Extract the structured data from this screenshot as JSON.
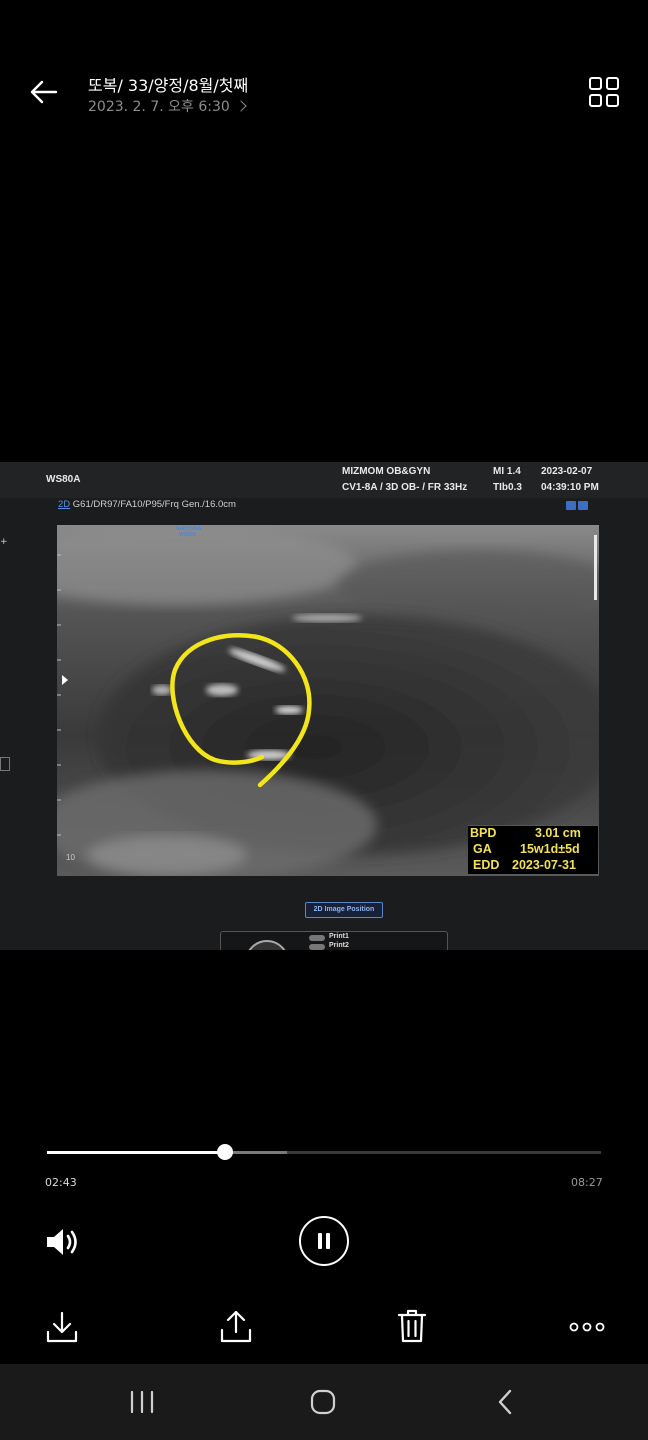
{
  "header": {
    "title": "또복/ 33/양정/8월/첫째",
    "subtitle": "2023. 2. 7. 오후 6:30"
  },
  "ultrasound": {
    "model": "WS80A",
    "clinic": "MIZMOM OB&GYN",
    "probe": "CV1-8A / 3D OB- / FR 33Hz",
    "mi": "MI  1.4",
    "tib": "TIb0.3",
    "date": "2023-02-07",
    "time": "04:39:10 PM",
    "mode": "2D",
    "params": "G61/DR97/FA10/P95/Frq Gen./16.0cm",
    "logo_line1": "SAMSUNG",
    "logo_line2": "WS80A",
    "depth_label": "10",
    "measurements": {
      "bpd_label": "BPD",
      "bpd_value": "3.01 cm",
      "ga_label": "GA",
      "ga_value": "15w1d±5d",
      "edd_label": "EDD",
      "edd_value": "2023-07-31"
    },
    "position_button": "2D Image Position",
    "print1": "Print1",
    "print2": "Print2",
    "annotation_color": "#f2e61a"
  },
  "player": {
    "current_time": "02:43",
    "duration": "08:27",
    "progress": 0.321,
    "buffered": 0.433
  },
  "icons": {
    "back": "back-arrow-icon",
    "grid": "grid-view-icon",
    "volume": "volume-icon",
    "pause": "pause-icon",
    "download": "download-icon",
    "share": "share-icon",
    "delete": "trash-icon",
    "more": "more-icon"
  }
}
